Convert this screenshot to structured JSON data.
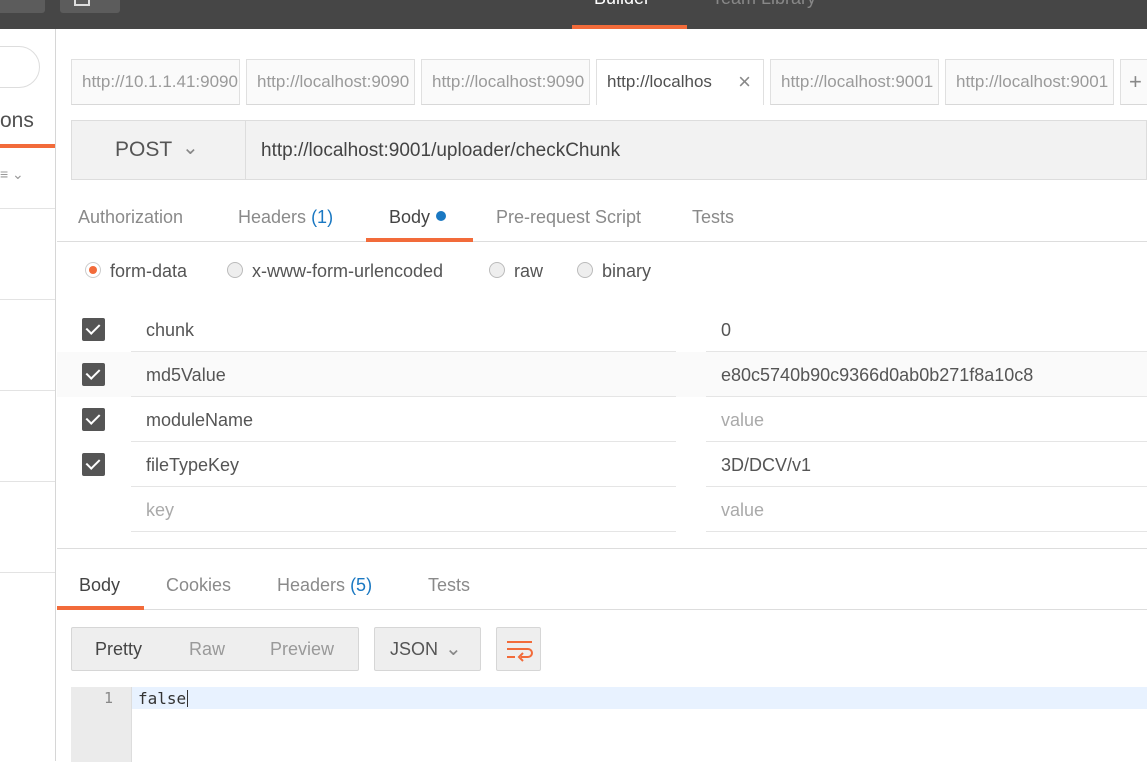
{
  "topbar": {
    "mode_builder": "Builder",
    "mode_team": "Team Library"
  },
  "sidebar": {
    "tab_label": "ons",
    "sort_icon": "sort-icon"
  },
  "tabs": [
    {
      "label": "http://10.1.1.41:9090"
    },
    {
      "label": "http://localhost:9090"
    },
    {
      "label": "http://localhost:9090"
    },
    {
      "label": "http://localhos",
      "active": true,
      "close": "×"
    },
    {
      "label": "http://localhost:9001"
    },
    {
      "label": "http://localhost:9001"
    }
  ],
  "tabs_plus": "+",
  "request": {
    "method": "POST",
    "url": "http://localhost:9001/uploader/checkChunk"
  },
  "req_tabs": {
    "authorization": "Authorization",
    "headers": "Headers",
    "headers_count": "(1)",
    "body": "Body",
    "prerequest": "Pre-request Script",
    "tests": "Tests"
  },
  "body_types": {
    "form_data": "form-data",
    "urlencoded": "x-www-form-urlencoded",
    "raw": "raw",
    "binary": "binary",
    "selected": "form-data"
  },
  "params": [
    {
      "key": "chunk",
      "value": "0",
      "checked": true
    },
    {
      "key": "md5Value",
      "value": "e80c5740b90c9366d0ab0b271f8a10c8",
      "checked": true
    },
    {
      "key": "moduleName",
      "value": "value",
      "checked": true
    },
    {
      "key": "fileTypeKey",
      "value": "3D/DCV/v1",
      "checked": true
    }
  ],
  "new_param": {
    "key": "key",
    "value": "value"
  },
  "response": {
    "tabs": {
      "body": "Body",
      "cookies": "Cookies",
      "headers": "Headers",
      "headers_count": "(5)",
      "tests": "Tests"
    },
    "view": {
      "pretty": "Pretty",
      "raw": "Raw",
      "preview": "Preview"
    },
    "format": "JSON",
    "line_number": "1",
    "content": "false"
  },
  "colors": {
    "accent": "#f26b3a",
    "link": "#1a78c2",
    "topbar": "#464646"
  }
}
